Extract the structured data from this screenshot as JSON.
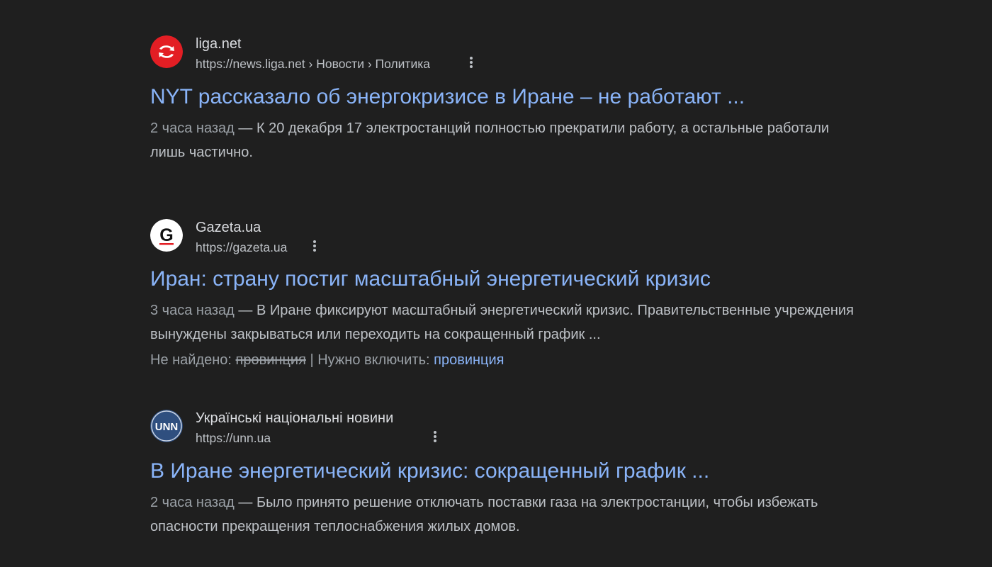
{
  "colors": {
    "background": "#1f1f1f",
    "title_link": "#8ab4f8",
    "site_name": "#dadce0",
    "snippet_text": "#bdc1c6",
    "muted_text": "#9aa0a6",
    "liga_favicon": "#e31e24",
    "unn_favicon": "#2f4f7f"
  },
  "results": [
    {
      "favicon_icon": "liga-logo-icon",
      "site_name": "liga.net",
      "url": "https://news.liga.net › Новости › Политика",
      "title": "NYT рассказало об энергокризисе в Иране – не работают ...",
      "date": "2 часа назад",
      "separator": " — ",
      "snippet": "К 20 декабря 17 электростанций полностью прекратили работу, а остальные работали лишь частично."
    },
    {
      "favicon_icon": "gazeta-logo-icon",
      "site_name": "Gazeta.ua",
      "url": "https://gazeta.ua",
      "title": "Иран: страну постиг масштабный энергетический кризис",
      "date": "3 часа назад",
      "separator": " — ",
      "snippet": "В Иране фиксируют масштабный энергетический кризис. Правительственные учреждения вынуждены закрываться или переходить на сокращенный график ...",
      "missing_label": "Не найдено: ",
      "missing_term": "провинция",
      "missing_divider": " | ",
      "must_include_label": "Нужно включить: ",
      "must_include_term": "провинция"
    },
    {
      "favicon_icon": "unn-logo-icon",
      "favicon_text": "UNN",
      "site_name": "Українські національні новини",
      "url": "https://unn.ua",
      "title": "В Иране энергетический кризис: сокращенный график ...",
      "date": "2 часа назад",
      "separator": " — ",
      "snippet": "Было принято решение отключать поставки газа на электростанции, чтобы избежать опасности прекращения теплоснабжения жилых домов."
    }
  ]
}
